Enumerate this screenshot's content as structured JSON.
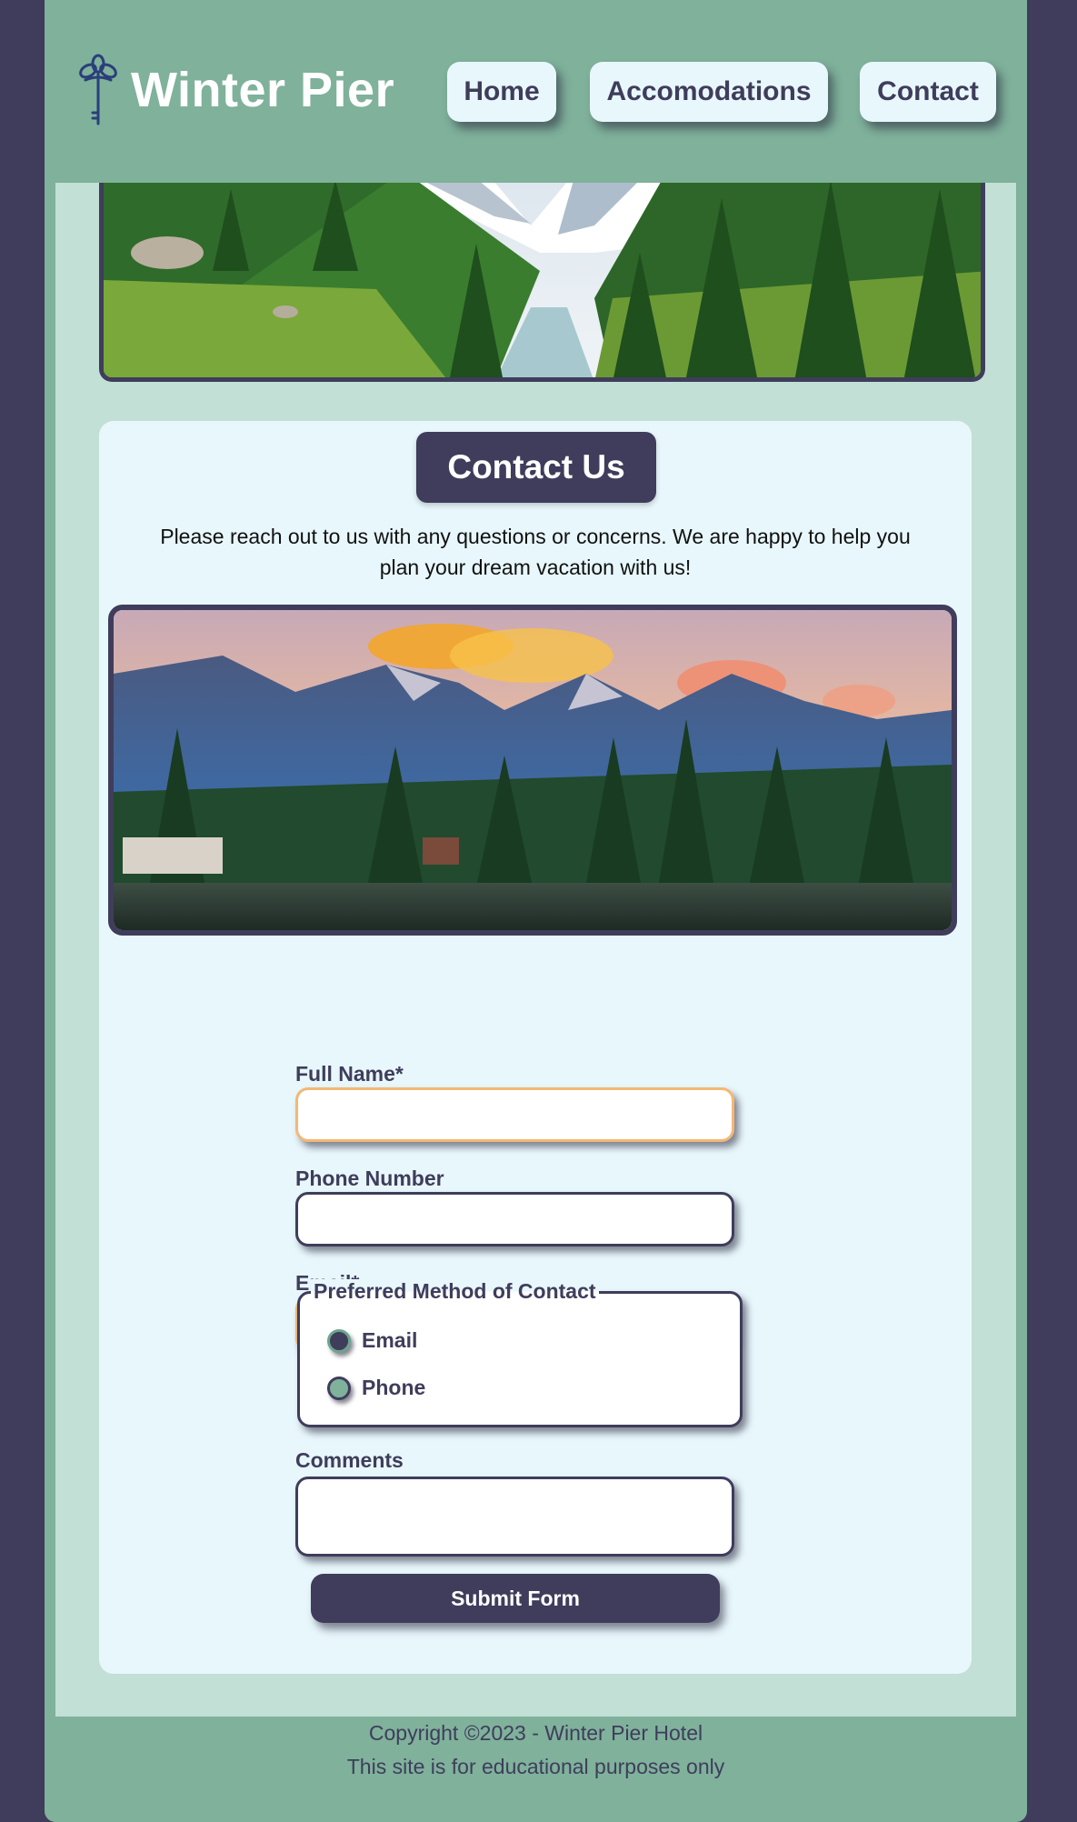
{
  "site": {
    "brand": "Winter Pier",
    "logo_icon": "key-icon"
  },
  "nav": {
    "items": [
      {
        "label": "Home"
      },
      {
        "label": "Accomodations"
      },
      {
        "label": "Contact"
      }
    ]
  },
  "contact": {
    "title": "Contact Us",
    "intro": "Please reach out to us with any questions or concerns. We are happy to help you plan your dream vacation with us!",
    "form": {
      "full_name_label": "Full Name*",
      "full_name_value": "",
      "phone_label": "Phone Number",
      "phone_value": "",
      "email_label": "Email*",
      "email_value": "",
      "preferred_legend": "Preferred Method of Contact",
      "options": [
        {
          "label": "Email"
        },
        {
          "label": "Phone"
        }
      ],
      "comments_label": "Comments",
      "comments_value": "",
      "submit_label": "Submit Form"
    }
  },
  "footer": {
    "copyright": "Copyright ©2023 - Winter Pier Hotel",
    "note": "This site is for educational purposes only"
  },
  "colors": {
    "page_bg": "#3f3d5b",
    "header_bg": "#7fb19b",
    "panel_bg": "#c2e0d6",
    "card_bg": "#e8f7fc",
    "accent": "#3f3d5b",
    "required_border": "#f4b874"
  }
}
